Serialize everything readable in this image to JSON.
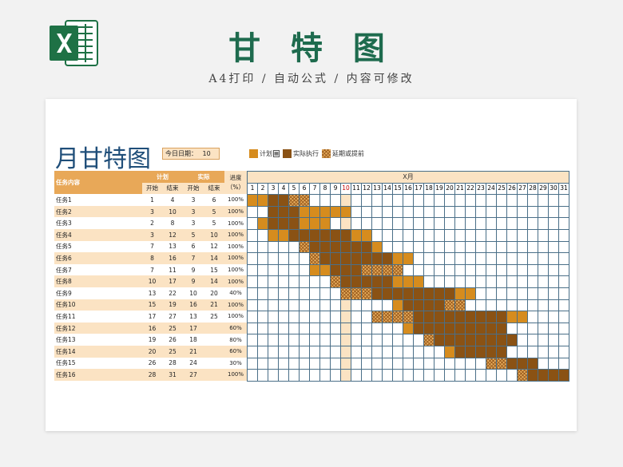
{
  "header": {
    "title": "甘 特 图",
    "subtitle": "A4打印 / 自动公式 / 内容可修改"
  },
  "sheet": {
    "title": "月甘特图",
    "today_label": "今日日期：",
    "today_value": 10,
    "legend": {
      "plan": "计划",
      "actual": "实际执行",
      "delay": "延期或提前"
    },
    "headers": {
      "task": "任务内容",
      "plan": "计划",
      "actual": "实际",
      "progress": "进度（%）",
      "start": "开始",
      "end": "结束",
      "month": "X月"
    },
    "days": [
      1,
      2,
      3,
      4,
      5,
      6,
      7,
      8,
      9,
      10,
      11,
      12,
      13,
      14,
      15,
      16,
      17,
      18,
      19,
      20,
      21,
      22,
      23,
      24,
      25,
      26,
      27,
      28,
      29,
      30,
      31
    ],
    "tasks": [
      {
        "name": "任务1",
        "plan_start": 1,
        "plan_end": 4,
        "act_start": 3,
        "act_end": 6,
        "progress": "100%"
      },
      {
        "name": "任务2",
        "plan_start": 3,
        "plan_end": 10,
        "act_start": 3,
        "act_end": 5,
        "progress": "100%"
      },
      {
        "name": "任务3",
        "plan_start": 2,
        "plan_end": 8,
        "act_start": 3,
        "act_end": 5,
        "progress": "100%"
      },
      {
        "name": "任务4",
        "plan_start": 3,
        "plan_end": 12,
        "act_start": 5,
        "act_end": 10,
        "progress": "100%"
      },
      {
        "name": "任务5",
        "plan_start": 7,
        "plan_end": 13,
        "act_start": 6,
        "act_end": 12,
        "progress": "100%"
      },
      {
        "name": "任务6",
        "plan_start": 8,
        "plan_end": 16,
        "act_start": 7,
        "act_end": 14,
        "progress": "100%"
      },
      {
        "name": "任务7",
        "plan_start": 7,
        "plan_end": 11,
        "act_start": 9,
        "act_end": 15,
        "progress": "100%"
      },
      {
        "name": "任务8",
        "plan_start": 10,
        "plan_end": 17,
        "act_start": 9,
        "act_end": 14,
        "progress": "100%"
      },
      {
        "name": "任务9",
        "plan_start": 13,
        "plan_end": 22,
        "act_start": 10,
        "act_end": 20,
        "progress": "40%"
      },
      {
        "name": "任务10",
        "plan_start": 15,
        "plan_end": 19,
        "act_start": 16,
        "act_end": 21,
        "progress": "100%"
      },
      {
        "name": "任务11",
        "plan_start": 17,
        "plan_end": 27,
        "act_start": 13,
        "act_end": 25,
        "progress": "100%"
      },
      {
        "name": "任务12",
        "plan_start": 16,
        "plan_end": 25,
        "act_start": 17,
        "act_end": "",
        "progress": "60%"
      },
      {
        "name": "任务13",
        "plan_start": 19,
        "plan_end": 26,
        "act_start": 18,
        "act_end": "",
        "progress": "80%"
      },
      {
        "name": "任务14",
        "plan_start": 20,
        "plan_end": 25,
        "act_start": 21,
        "act_end": "",
        "progress": "60%"
      },
      {
        "name": "任务15",
        "plan_start": 26,
        "plan_end": 28,
        "act_start": 24,
        "act_end": "",
        "progress": "30%"
      },
      {
        "name": "任务16",
        "plan_start": 28,
        "plan_end": 31,
        "act_start": 27,
        "act_end": "",
        "progress": "100%"
      }
    ]
  },
  "colors": {
    "brand_green": "#1e6b4e",
    "plan": "#d68c1e",
    "actual": "#8a5214",
    "header_fill": "#e8a858",
    "band": "#fbe3c3"
  },
  "icons": {
    "logo": "excel-logo-icon"
  }
}
